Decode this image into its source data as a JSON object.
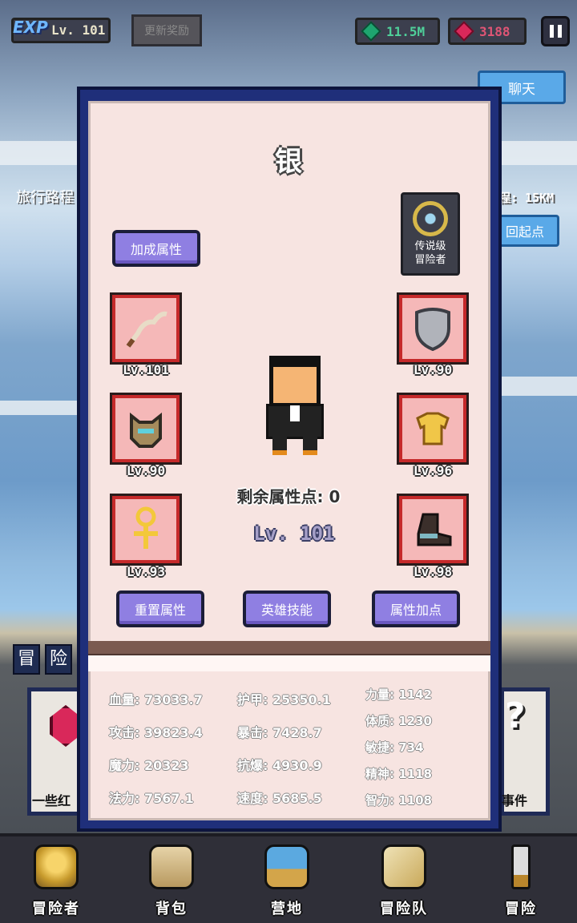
{
  "header": {
    "exp_logo": "EXP",
    "level": "Lv. 101",
    "update_reward": "更新奖励",
    "green_gems": "11.5M",
    "red_gems": "3188"
  },
  "background": {
    "chat": "聊天",
    "travel_label": "旅行路程",
    "distance": "程: 15KM",
    "return": "回起点",
    "adventure_tag": [
      "冒",
      "险"
    ],
    "event_left": "一些红",
    "event_right": "事件"
  },
  "modal": {
    "title": "银",
    "bonus_button": "加成属性",
    "legend_badge": [
      "传说级",
      "冒险者"
    ],
    "slots": [
      {
        "icon": "bone-whip-icon",
        "level": "Lv.101"
      },
      {
        "icon": "shield-icon",
        "level": "Lv.90"
      },
      {
        "icon": "helmet-icon",
        "level": "Lv.90"
      },
      {
        "icon": "golden-armor-icon",
        "level": "Lv.96"
      },
      {
        "icon": "ankh-necklace-icon",
        "level": "Lv.93"
      },
      {
        "icon": "boots-icon",
        "level": "Lv.98"
      }
    ],
    "remaining_points": "剩余属性点: 0",
    "hero_level": "Lv. 101",
    "buttons": {
      "reset": "重置属性",
      "skills": "英雄技能",
      "add_points": "属性加点"
    },
    "stats": {
      "col1": [
        "血量: 73033.7",
        "攻击: 39823.4",
        "魔力: 20323",
        "法力: 7567.1"
      ],
      "col2": [
        "护甲: 25350.1",
        "暴击: 7428.7",
        "抗爆: 4930.9",
        "速度: 5685.5"
      ],
      "col3": [
        "力量: 1142",
        "体质: 1230",
        "敏捷: 734",
        "精神: 1118",
        "智力: 1108"
      ]
    }
  },
  "nav": {
    "items": [
      {
        "label": "冒险者",
        "icon": "knight-helmet-icon"
      },
      {
        "label": "背包",
        "icon": "backpack-icon"
      },
      {
        "label": "营地",
        "icon": "camp-banner-icon"
      },
      {
        "label": "冒险队",
        "icon": "team-book-icon"
      },
      {
        "label": "冒险",
        "icon": "sword-icon"
      }
    ]
  },
  "colors": {
    "modal_border": "#1f2f7a",
    "modal_bg": "#f7e4e1",
    "button_purple": "#8f7fe2",
    "slot_red": "#c5292a"
  }
}
